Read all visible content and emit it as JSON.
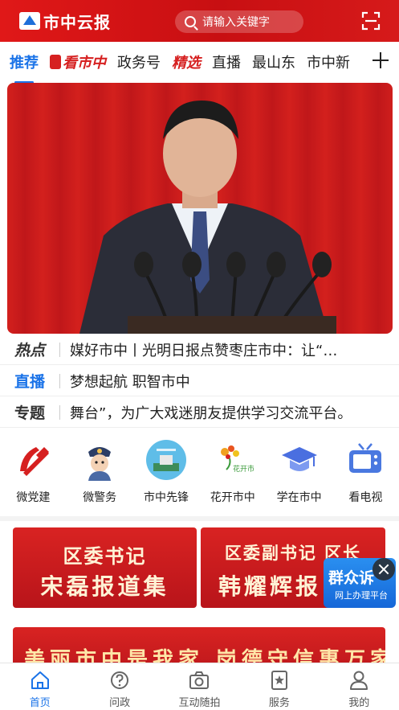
{
  "header": {
    "app_name": "市中云报",
    "search_placeholder": "请输入关键字"
  },
  "tabs": [
    {
      "label": "推荐",
      "active": true
    },
    {
      "label": "看市中",
      "active": false
    },
    {
      "label": "政务号",
      "active": false
    },
    {
      "label": "精选",
      "active": false
    },
    {
      "label": "直播",
      "active": false
    },
    {
      "label": "最山东",
      "active": false
    },
    {
      "label": "市中新",
      "active": false
    }
  ],
  "news": [
    {
      "tag": "热点",
      "text": "媒好市中丨光明日报点赞枣庄市中：让“…"
    },
    {
      "tag": "直播",
      "text": "梦想起航  职智市中"
    },
    {
      "tag": "专题",
      "text": "舞台”，为广大戏迷朋友提供学习交流平台。"
    }
  ],
  "services": [
    {
      "label": "微党建",
      "icon": "party-emblem-icon"
    },
    {
      "label": "微警务",
      "icon": "police-icon"
    },
    {
      "label": "市中先锋",
      "icon": "pioneer-icon"
    },
    {
      "label": "花开市中",
      "icon": "flower-icon"
    },
    {
      "label": "学在市中",
      "icon": "graduation-cap-icon"
    },
    {
      "label": "看电视",
      "icon": "tv-icon"
    }
  ],
  "banners": [
    {
      "line1": "区委书记",
      "line2": "宋磊报道集"
    },
    {
      "line1": "区委副书记 区长",
      "line2": "韩耀辉报"
    }
  ],
  "banner_bottom": "美丽市中是我家  岗德守信惠万家",
  "floating": {
    "title": "群众诉",
    "subtitle": "网上办理平台"
  },
  "bottom_nav": [
    {
      "label": "首页",
      "active": true
    },
    {
      "label": "问政",
      "active": false
    },
    {
      "label": "互动随拍",
      "active": false
    },
    {
      "label": "服务",
      "active": false
    },
    {
      "label": "我的",
      "active": false
    }
  ],
  "colors": {
    "brand_red": "#d61a1a",
    "accent_blue": "#1a73e8"
  }
}
